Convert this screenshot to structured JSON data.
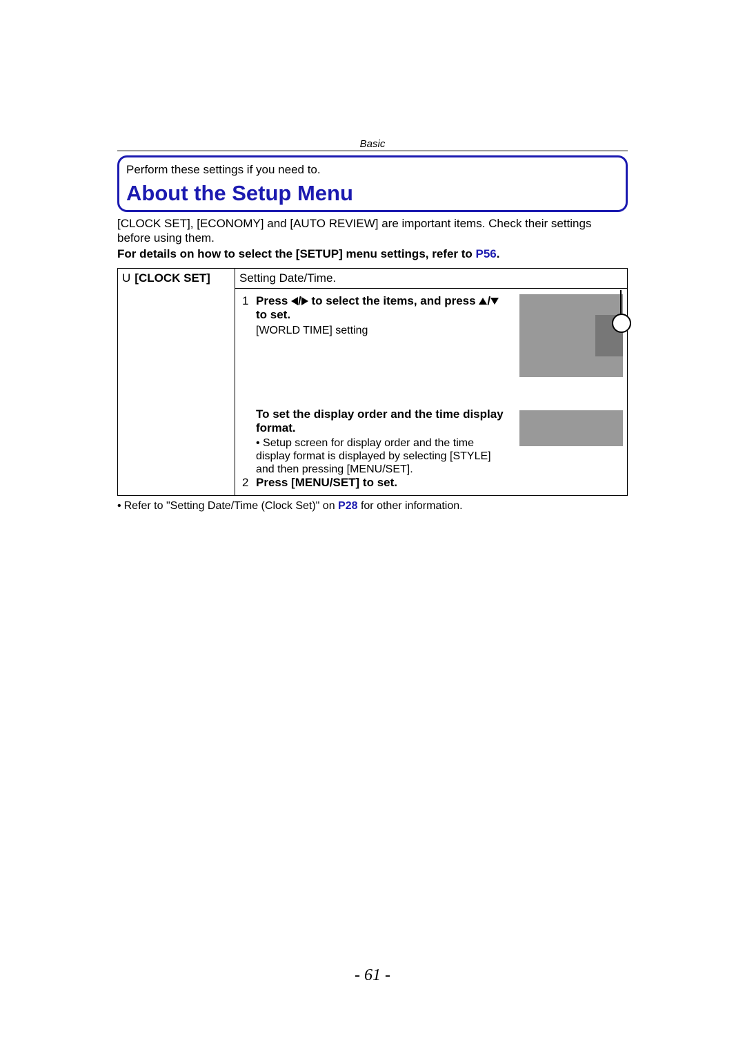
{
  "header": {
    "section": "Basic"
  },
  "box": {
    "perform": "Perform these settings if you need to.",
    "title": "About the Setup Menu"
  },
  "intro": {
    "line1": "[CLOCK SET], [ECONOMY] and [AUTO REVIEW] are important items. Check their settings before using them.",
    "line2_prefix": "For details on how to select the [SETUP] menu settings, refer to ",
    "line2_link": "P56",
    "line2_suffix": "."
  },
  "table": {
    "left_icon": "U",
    "left_label": "[CLOCK SET]",
    "row1": "Setting Date/Time.",
    "step1_num": "1",
    "step1_a": "Press ",
    "step1_b": " to select the items, and press ",
    "step1_c": " to set.",
    "world_time": "[WORLD TIME] setting",
    "display_order_heading": "To set the display order and the time display format.",
    "display_order_bullet": "Setup screen for display order and the time display format is displayed by selecting [STYLE] and then pressing [MENU/SET].",
    "step2_num": "2",
    "step2_text": "Press [MENU/SET] to set."
  },
  "footnote": {
    "prefix": "Refer to \"Setting Date/Time (Clock Set)\" on ",
    "link": "P28",
    "suffix": " for other information."
  },
  "page_number": "- 61 -"
}
